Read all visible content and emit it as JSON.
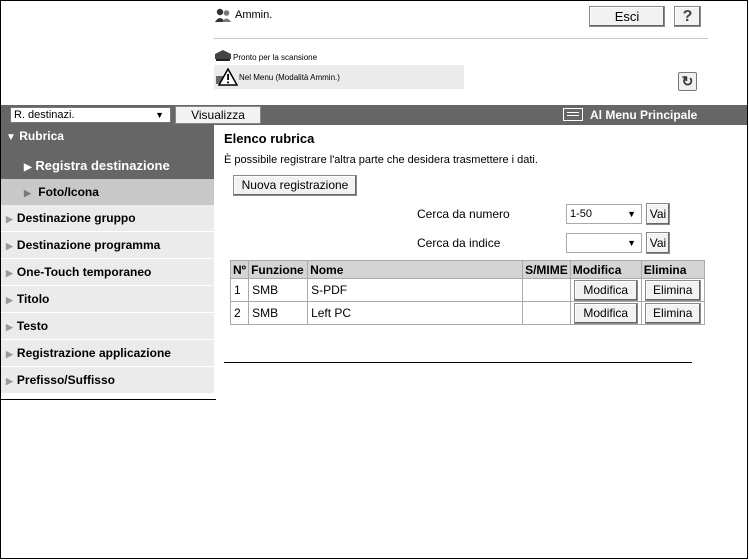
{
  "header": {
    "user": "Ammin.",
    "logout_label": "Esci",
    "help_label": "?",
    "status_scan": "Pronto per la scansione",
    "status_menu": "Nel Menu (Modalità Ammin.)",
    "refresh_icon": "refresh-icon"
  },
  "toolbar": {
    "select_value": "R. destinazi.",
    "view_label": "Visualizza",
    "main_menu_label": "Al Menu Principale"
  },
  "sidebar": {
    "section": "Rubrica",
    "sub_items": [
      "Registra destinazione",
      "Foto/Icona"
    ],
    "items": [
      "Destinazione gruppo",
      "Destinazione programma",
      "One-Touch temporaneo",
      "Titolo",
      "Testo",
      "Registrazione applicazione",
      "Prefisso/Suffisso"
    ]
  },
  "content": {
    "title": "Elenco rubrica",
    "description": "È possibile registrare l'altra parte che desidera trasmettere i dati.",
    "new_button": "Nuova registrazione",
    "search_number_label": "Cerca da numero",
    "search_number_value": "1-50",
    "search_index_label": "Cerca da indice",
    "search_index_value": "",
    "go_label": "Vai"
  },
  "table": {
    "headers": [
      "Nº",
      "Funzione",
      "Nome",
      "S/MIME",
      "Modifica",
      "Elimina"
    ],
    "rows": [
      {
        "num": "1",
        "function": "SMB",
        "name": "S-PDF",
        "smime": "",
        "edit": "Modifica",
        "delete": "Elimina"
      },
      {
        "num": "2",
        "function": "SMB",
        "name": "Left PC",
        "smime": "",
        "edit": "Modifica",
        "delete": "Elimina"
      }
    ]
  }
}
